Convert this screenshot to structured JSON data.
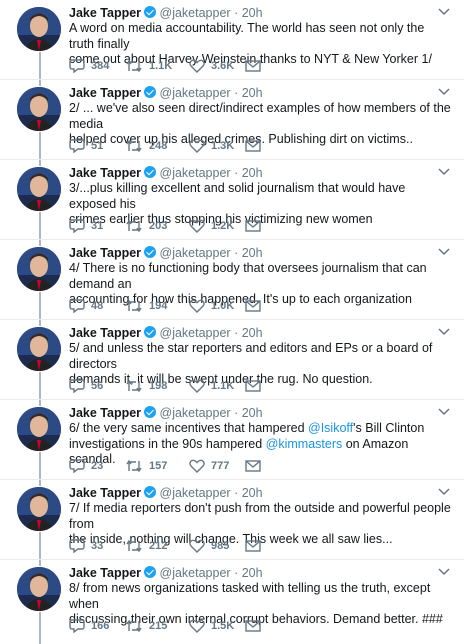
{
  "author": {
    "name": "Jake Tapper",
    "handle": "@jaketapper",
    "separator": "·"
  },
  "tweets": [
    {
      "time": "20h",
      "text": [
        "A word on media accountability. The world has seen not only the truth finally",
        "come out about Harvey Weinstein thanks to NYT & New Yorker 1/"
      ],
      "replies": "384",
      "retweets": "1.1K",
      "likes": "3.6K"
    },
    {
      "time": "20h",
      "text": [
        "2/ ... we've also seen direct/indirect examples of how members of the media",
        "helped cover up his alleged crimes. Publishing dirt on victims.."
      ],
      "replies": "51",
      "retweets": "248",
      "likes": "1.3K"
    },
    {
      "time": "20h",
      "text": [
        "3/...plus killing excellent and solid journalism that would have exposed his",
        "crimes earlier thus stopping his victimizing new women"
      ],
      "replies": "31",
      "retweets": "203",
      "likes": "1.2K"
    },
    {
      "time": "20h",
      "text": [
        "4/ There is no functioning body that oversees journalism that can demand an",
        "accounting for how this happened. It's up to each organization"
      ],
      "replies": "48",
      "retweets": "194",
      "likes": "1.0K"
    },
    {
      "time": "20h",
      "text": [
        "5/ and unless the star reporters and editors and EPs or a board of directors",
        "demands it, it will be swept under the rug. No question."
      ],
      "replies": "56",
      "retweets": "198",
      "likes": "1.1K"
    },
    {
      "time": "20h",
      "text_parts": {
        "l1a": "6/ the very same incentives that hampered ",
        "l1m": "@Isikoff",
        "l1b": "'s Bill Clinton",
        "l2a": "investigations in the 90s hampered ",
        "l2m": "@kimmasters",
        "l2b": " on Amazon scandal."
      },
      "replies": "23",
      "retweets": "157",
      "likes": "777"
    },
    {
      "time": "20h",
      "text": [
        "7/ If media reporters don't push from the outside and powerful people from",
        "the inside, nothing will change. This week we all saw lies..."
      ],
      "replies": "33",
      "retweets": "212",
      "likes": "985"
    },
    {
      "time": "20h",
      "text": [
        "8/ from news organizations tasked with telling us the truth, except when",
        "discussing their own internal corrupt behaviors. Demand better. ###"
      ],
      "replies": "166",
      "retweets": "215",
      "likes": "1.5K"
    }
  ],
  "colors": {
    "accent": "#1da1f2",
    "link": "#1b95e0",
    "muted": "#657786",
    "thread": "#aab8c2"
  }
}
